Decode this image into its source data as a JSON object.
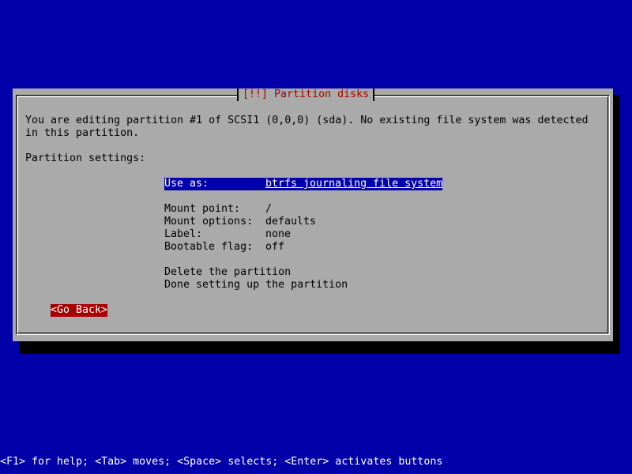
{
  "dialog": {
    "title": "[!!] Partition disks",
    "intro_line1": "You are editing partition #1 of SCSI1 (0,0,0) (sda). No existing file system was detected",
    "intro_line2": "in this partition.",
    "settings_heading": "Partition settings:",
    "settings": [
      {
        "key": "Use as:",
        "value": "btrfs journaling file system",
        "selected": true
      },
      {
        "key": "Mount point:",
        "value": "/"
      },
      {
        "key": "Mount options:",
        "value": "defaults"
      },
      {
        "key": "Label:",
        "value": "none"
      },
      {
        "key": "Bootable flag:",
        "value": "off"
      }
    ],
    "actions": [
      {
        "label": "Delete the partition"
      },
      {
        "label": "Done setting up the partition"
      }
    ],
    "go_back_label": "<Go Back>"
  },
  "status_bar": {
    "text": "<F1> for help; <Tab> moves; <Space> selects; <Enter> activates buttons"
  },
  "colors": {
    "background": "#0000a8",
    "dialog": "#aaaaaa",
    "title_text": "#a80000",
    "selection": "#0000a8",
    "button_highlight": "#a80000"
  }
}
